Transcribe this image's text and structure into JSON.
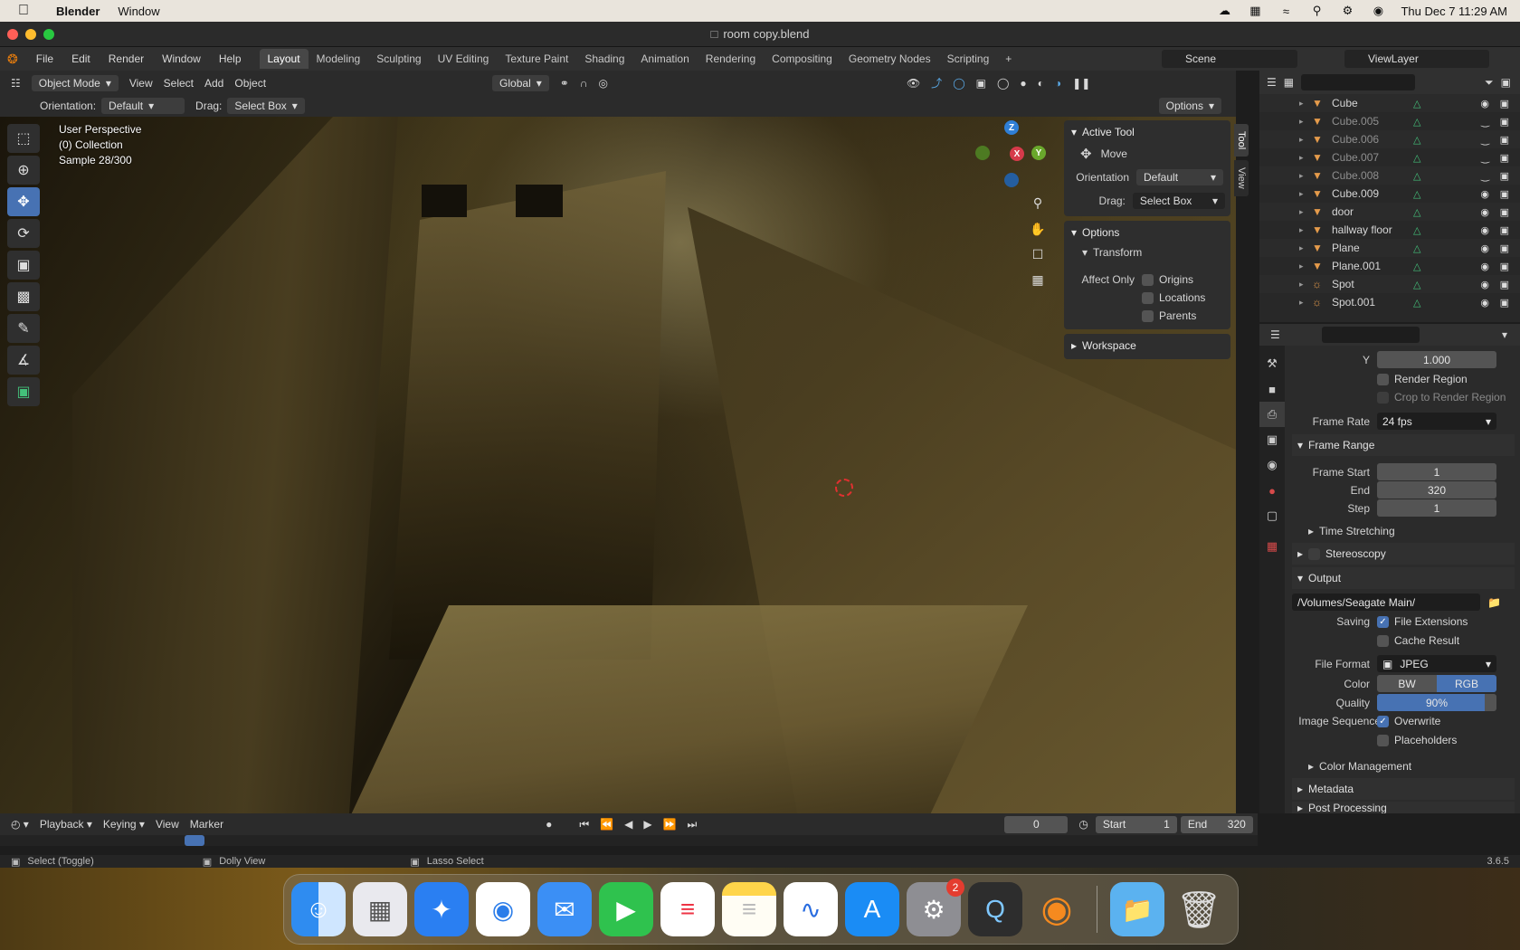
{
  "menubar": {
    "app": "Blender",
    "items": [
      "Window"
    ],
    "datetime": "Thu Dec 7  11:29 AM"
  },
  "window": {
    "title": "room copy.blend"
  },
  "topbar": {
    "menus": [
      "File",
      "Edit",
      "Render",
      "Window",
      "Help"
    ],
    "workspaces": [
      "Layout",
      "Modeling",
      "Sculpting",
      "UV Editing",
      "Texture Paint",
      "Shading",
      "Animation",
      "Rendering",
      "Compositing",
      "Geometry Nodes",
      "Scripting"
    ],
    "active_workspace": "Layout",
    "scene": "Scene",
    "view_layer": "ViewLayer"
  },
  "viewport_header": {
    "mode": "Object Mode",
    "menus": [
      "View",
      "Select",
      "Add",
      "Object"
    ],
    "transform_orientation": "Global"
  },
  "tool_header": {
    "orientation_label": "Orientation:",
    "orientation_value": "Default",
    "drag_label": "Drag:",
    "drag_value": "Select Box",
    "options_label": "Options"
  },
  "viewport": {
    "perspective": "User Perspective",
    "collection": "(0) Collection",
    "sample": "Sample 28/300"
  },
  "npanel": {
    "active_tool_title": "Active Tool",
    "tool_name": "Move",
    "orientation_label": "Orientation",
    "orientation_value": "Default",
    "drag_label": "Drag:",
    "drag_value": "Select Box",
    "options_title": "Options",
    "transform_title": "Transform",
    "affect_only_label": "Affect Only",
    "checkboxes": [
      "Origins",
      "Locations",
      "Parents"
    ],
    "workspace_title": "Workspace",
    "tabs": [
      "Tool",
      "View"
    ]
  },
  "outliner": {
    "items": [
      {
        "name": "Cube",
        "type": "mesh",
        "dim": false,
        "visible": true
      },
      {
        "name": "Cube.005",
        "type": "mesh",
        "dim": true,
        "visible": false
      },
      {
        "name": "Cube.006",
        "type": "mesh",
        "dim": true,
        "visible": false
      },
      {
        "name": "Cube.007",
        "type": "mesh",
        "dim": true,
        "visible": false
      },
      {
        "name": "Cube.008",
        "type": "mesh",
        "dim": true,
        "visible": false
      },
      {
        "name": "Cube.009",
        "type": "mesh",
        "dim": false,
        "visible": true
      },
      {
        "name": "door",
        "type": "mesh",
        "dim": false,
        "visible": true
      },
      {
        "name": "hallway floor",
        "type": "mesh",
        "dim": false,
        "visible": true
      },
      {
        "name": "Plane",
        "type": "mesh",
        "dim": false,
        "visible": true
      },
      {
        "name": "Plane.001",
        "type": "mesh",
        "dim": false,
        "visible": true
      },
      {
        "name": "Spot",
        "type": "light",
        "dim": false,
        "visible": true
      },
      {
        "name": "Spot.001",
        "type": "light",
        "dim": false,
        "visible": true
      }
    ]
  },
  "properties": {
    "y_label": "Y",
    "y_value": "1.000",
    "render_region": "Render Region",
    "crop_region": "Crop to Render Region",
    "frame_rate_label": "Frame Rate",
    "frame_rate_value": "24 fps",
    "frame_range_title": "Frame Range",
    "frame_start_label": "Frame Start",
    "frame_start": "1",
    "end_label": "End",
    "end": "320",
    "step_label": "Step",
    "step": "1",
    "time_stretching": "Time Stretching",
    "stereoscopy": "Stereoscopy",
    "output_title": "Output",
    "output_path": "/Volumes/Seagate Main/",
    "saving_label": "Saving",
    "file_extensions": "File Extensions",
    "cache_result": "Cache Result",
    "file_format_label": "File Format",
    "file_format": "JPEG",
    "color_label": "Color",
    "color_bw": "BW",
    "color_rgb": "RGB",
    "quality_label": "Quality",
    "quality": "90%",
    "quality_fraction": 0.9,
    "image_sequence_label": "Image Sequence",
    "overwrite": "Overwrite",
    "placeholders": "Placeholders",
    "color_management": "Color Management",
    "metadata": "Metadata",
    "post_processing": "Post Processing"
  },
  "timeline": {
    "menus": [
      "Playback",
      "Keying",
      "View",
      "Marker"
    ],
    "current_frame": "0",
    "start_label": "Start",
    "start": "1",
    "end_label": "End",
    "end": "320"
  },
  "statusbar": {
    "select": "Select (Toggle)",
    "dolly": "Dolly View",
    "lasso": "Lasso Select",
    "version": "3.6.5"
  },
  "dock": {
    "settings_badge": "2"
  }
}
